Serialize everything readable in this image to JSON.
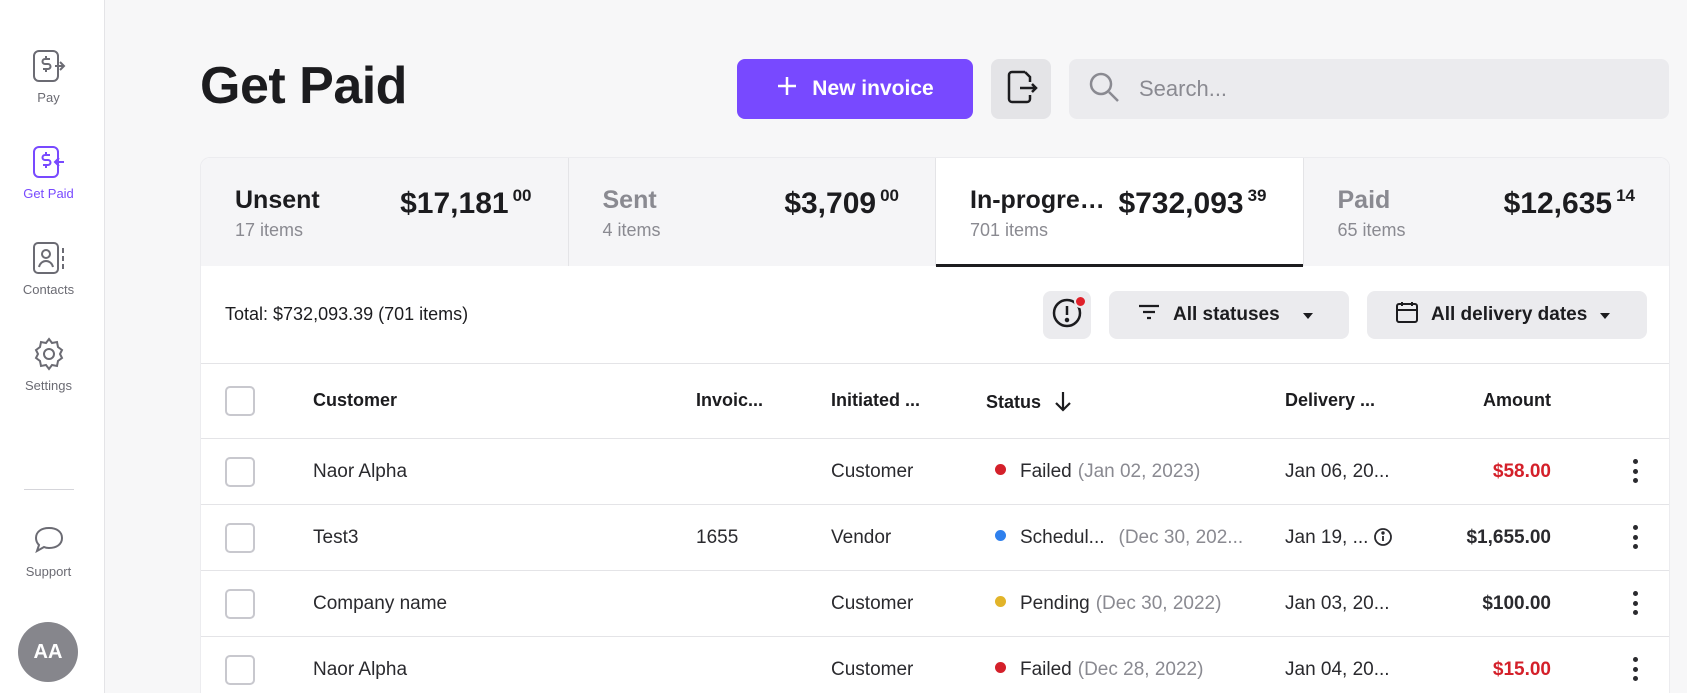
{
  "sidebar": {
    "items": [
      {
        "label": "Pay",
        "icon": "dollar-pay-icon"
      },
      {
        "label": "Get Paid",
        "icon": "dollar-get-paid-icon"
      },
      {
        "label": "Contacts",
        "icon": "contacts-icon"
      },
      {
        "label": "Settings",
        "icon": "gear-icon"
      },
      {
        "label": "Support",
        "icon": "chat-bubble-icon"
      }
    ],
    "avatar_initials": "AA"
  },
  "header": {
    "title": "Get Paid",
    "new_invoice_label": "New invoice",
    "search_placeholder": "Search..."
  },
  "tabs": [
    {
      "name": "Unsent",
      "count": "17 items",
      "amount": "$17,181",
      "cents": "00"
    },
    {
      "name": "Sent",
      "count": "4 items",
      "amount": "$3,709",
      "cents": "00"
    },
    {
      "name": "In-progress",
      "count": "701 items",
      "amount": "$732,093",
      "cents": "39"
    },
    {
      "name": "Paid",
      "count": "65 items",
      "amount": "$12,635",
      "cents": "14"
    }
  ],
  "filters": {
    "total_text": "Total: $732,093.39 (701 items)",
    "status_label": "All statuses",
    "date_label": "All delivery dates"
  },
  "table": {
    "columns": {
      "customer": "Customer",
      "invoice": "Invoic...",
      "initiated": "Initiated ...",
      "status": "Status",
      "delivery": "Delivery ...",
      "amount": "Amount"
    },
    "rows": [
      {
        "customer": "Naor Alpha",
        "invoice": "",
        "initiated": "Customer",
        "status": "Failed",
        "status_date": "(Jan 02, 2023)",
        "delivery": "Jan 06, 20...",
        "amount": "$58.00"
      },
      {
        "customer": "Test3",
        "invoice": "1655",
        "initiated": "Vendor",
        "status": "Schedul...",
        "status_date": "(Dec 30, 202...",
        "delivery": "Jan 19, ...",
        "amount": "$1,655.00"
      },
      {
        "customer": "Company name",
        "invoice": "",
        "initiated": "Customer",
        "status": "Pending",
        "status_date": "(Dec 30, 2022)",
        "delivery": "Jan 03, 20...",
        "amount": "$100.00"
      },
      {
        "customer": "Naor Alpha",
        "invoice": "",
        "initiated": "Customer",
        "status": "Failed",
        "status_date": "(Dec 28, 2022)",
        "delivery": "Jan 04, 20...",
        "amount": "$15.00"
      }
    ]
  },
  "colors": {
    "accent": "#7849ff",
    "failed": "#d4202a",
    "scheduled": "#2f80ed",
    "pending": "#e2b429"
  }
}
